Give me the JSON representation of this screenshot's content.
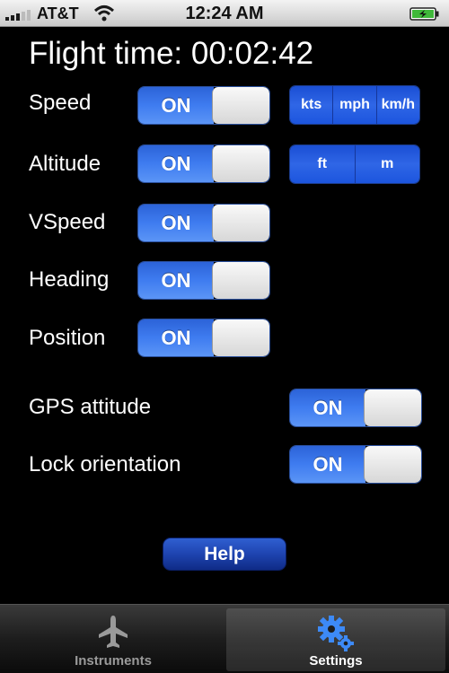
{
  "status_bar": {
    "carrier": "AT&T",
    "time": "12:24 AM",
    "icons": [
      "signal-icon",
      "wifi-icon",
      "battery-charging-icon"
    ]
  },
  "main": {
    "flight_time": "Flight time: 00:02:42",
    "rows": [
      {
        "label": "Speed",
        "toggle": "ON"
      },
      {
        "label": "Altitude",
        "toggle": "ON"
      },
      {
        "label": "VSpeed",
        "toggle": "ON"
      },
      {
        "label": "Heading",
        "toggle": "ON"
      },
      {
        "label": "Position",
        "toggle": "ON"
      },
      {
        "label": "GPS attitude",
        "toggle": "ON"
      },
      {
        "label": "Lock orientation",
        "toggle": "ON"
      }
    ],
    "speed_units": [
      "kts",
      "mph",
      "km/h"
    ],
    "altitude_units": [
      "ft",
      "m"
    ],
    "help_label": "Help"
  },
  "tab_bar": {
    "tabs": [
      {
        "label": "Instruments",
        "icon": "airplane-icon",
        "selected": false
      },
      {
        "label": "Settings",
        "icon": "gears-icon",
        "selected": true
      }
    ]
  },
  "colors": {
    "toggle_on": "#3f7cf0",
    "segmented": "#2f66e6",
    "background": "#000000"
  }
}
